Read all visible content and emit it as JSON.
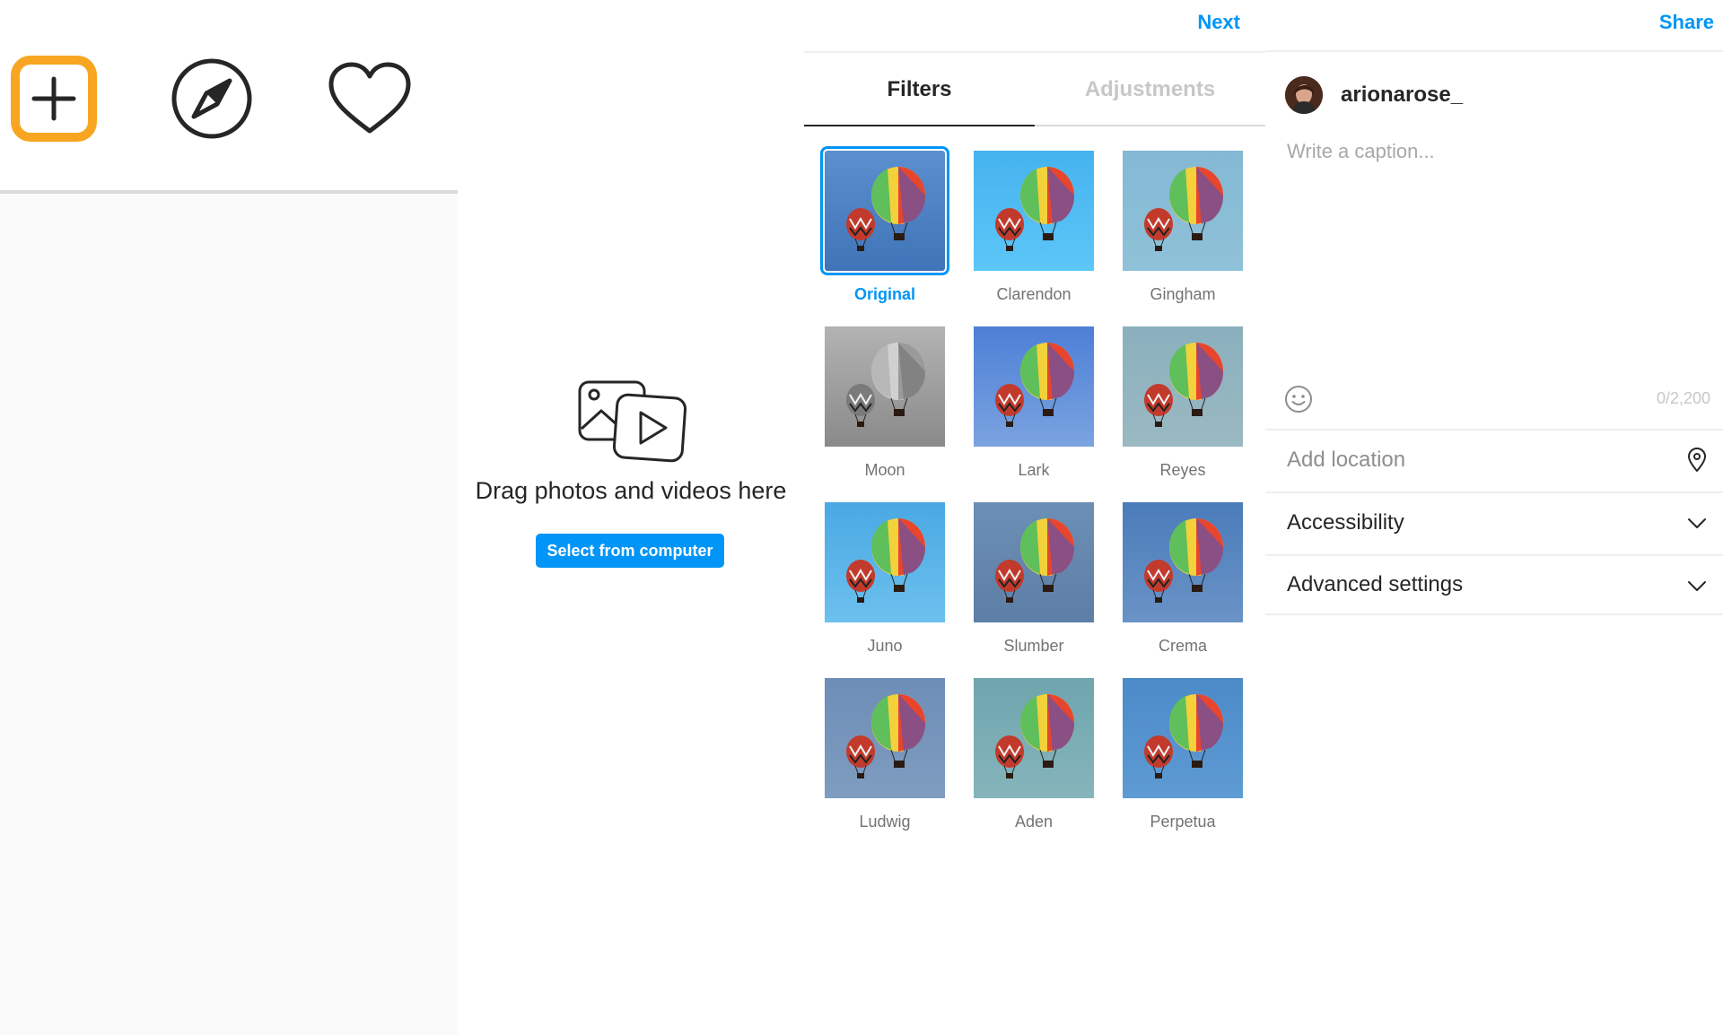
{
  "nav": {
    "icons": [
      "plus-square-icon",
      "compass-icon",
      "heart-icon"
    ],
    "active_color": "#f8a622"
  },
  "upload": {
    "icon": "photo-video-icon",
    "prompt": "Drag photos and videos here",
    "button_label": "Select from computer"
  },
  "filters_panel": {
    "next_label": "Next",
    "tabs": [
      {
        "label": "Filters",
        "active": true
      },
      {
        "label": "Adjustments",
        "active": false
      }
    ],
    "filters": [
      {
        "name": "Original",
        "selected": true
      },
      {
        "name": "Clarendon",
        "selected": false
      },
      {
        "name": "Gingham",
        "selected": false
      },
      {
        "name": "Moon",
        "selected": false
      },
      {
        "name": "Lark",
        "selected": false
      },
      {
        "name": "Reyes",
        "selected": false
      },
      {
        "name": "Juno",
        "selected": false
      },
      {
        "name": "Slumber",
        "selected": false
      },
      {
        "name": "Crema",
        "selected": false
      },
      {
        "name": "Ludwig",
        "selected": false
      },
      {
        "name": "Aden",
        "selected": false
      },
      {
        "name": "Perpetua",
        "selected": false
      }
    ]
  },
  "share_panel": {
    "share_label": "Share",
    "username": "arionarose_",
    "caption_placeholder": "Write a caption...",
    "caption_value": "",
    "char_count": "0/2,200",
    "add_location_label": "Add location",
    "accessibility_label": "Accessibility",
    "advanced_settings_label": "Advanced settings"
  },
  "colors": {
    "accent": "#0095f6",
    "create_highlight": "#f8a622"
  }
}
